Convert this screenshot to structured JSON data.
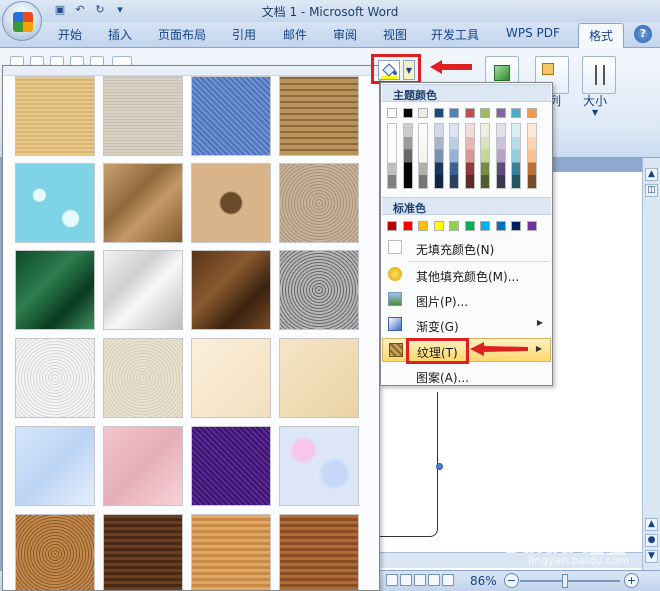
{
  "window": {
    "title": "文档 1 - Microsoft Word"
  },
  "quick_access": {
    "save_icon": "save-icon",
    "undo_icon": "undo-icon",
    "redo_icon": "redo-icon"
  },
  "tabs": [
    {
      "label": "开始"
    },
    {
      "label": "插入"
    },
    {
      "label": "页面布局"
    },
    {
      "label": "引用"
    },
    {
      "label": "邮件"
    },
    {
      "label": "审阅"
    },
    {
      "label": "视图"
    },
    {
      "label": "开发工具"
    },
    {
      "label": "WPS PDF"
    },
    {
      "label": "格式",
      "active": true
    }
  ],
  "ribbon": {
    "size_label": "大小",
    "column_label": "列"
  },
  "fill_menu": {
    "theme_colors_label": "主题颜色",
    "standard_colors_label": "标准色",
    "theme_colors": [
      "#ffffff",
      "#000000",
      "#eeece1",
      "#1f497d",
      "#4f81bd",
      "#c0504d",
      "#9bbb59",
      "#8064a2",
      "#4bacc6",
      "#f79646"
    ],
    "standard_colors": [
      "#c00000",
      "#ff0000",
      "#ffc000",
      "#ffff00",
      "#92d050",
      "#00b050",
      "#00b0f0",
      "#0070c0",
      "#002060",
      "#7030a0"
    ],
    "items": [
      {
        "label": "无填充颜色(N)",
        "icon": "no-fill-icon"
      },
      {
        "label": "其他填充颜色(M)...",
        "icon": "palette-icon"
      },
      {
        "label": "图片(P)...",
        "icon": "picture-icon"
      },
      {
        "label": "渐变(G)",
        "icon": "gradient-icon",
        "submenu": true
      },
      {
        "label": "纹理(T)",
        "icon": "texture-icon",
        "submenu": true,
        "highlighted": true
      },
      {
        "label": "图案(A)...",
        "icon": "pattern-icon"
      }
    ]
  },
  "textures": [
    "papyrus",
    "canvas",
    "denim",
    "woven-mat",
    "water-droplets",
    "paper-bag",
    "fish-fossil",
    "sand",
    "green-marble",
    "white-marble",
    "brown-marble",
    "granite",
    "newsprint",
    "recycled-paper",
    "parchment",
    "stationery",
    "blue-tissue-paper",
    "pink-tissue-paper",
    "purple-mesh",
    "bouquet",
    "cork",
    "walnut",
    "oak",
    "medium-wood"
  ],
  "status": {
    "zoom": "86%"
  },
  "watermark": {
    "text": "Baidu 经验",
    "sub": "jingyan.baidu.com"
  },
  "colors": {
    "highlight": "#e02020",
    "ribbon_text": "#15428b"
  }
}
